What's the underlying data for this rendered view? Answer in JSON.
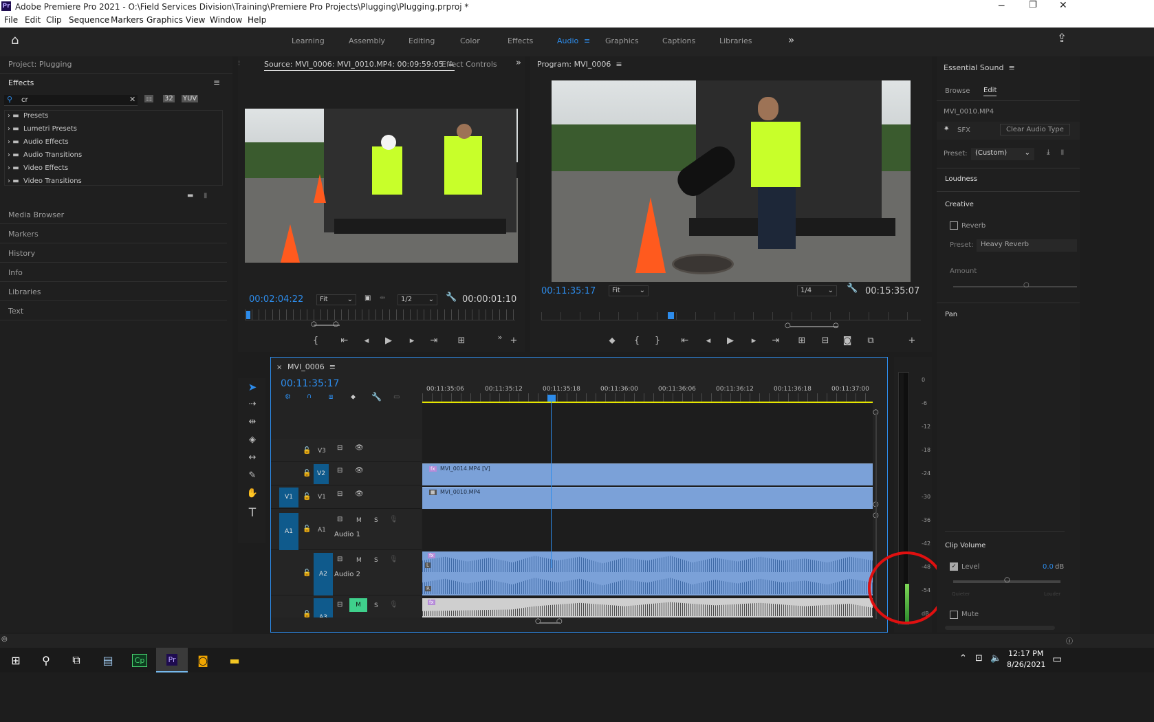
{
  "title_bar": {
    "app_icon": "Pr",
    "title": "Adobe Premiere Pro 2021 - O:\\Field Services Division\\Training\\Premiere Pro Projects\\Plugging\\Plugging.prproj *",
    "controls": [
      "minimize-icon",
      "restore-icon",
      "close-icon"
    ]
  },
  "menu": [
    "File",
    "Edit",
    "Clip",
    "Sequence",
    "Markers",
    "Graphics",
    "View",
    "Window",
    "Help"
  ],
  "workspaces": {
    "tabs": [
      "Learning",
      "Assembly",
      "Editing",
      "Color",
      "Effects",
      "Audio",
      "Graphics",
      "Captions",
      "Libraries"
    ],
    "active": "Audio",
    "more": "»"
  },
  "project_panel": {
    "title": "Project: Plugging",
    "effects_title": "Effects",
    "search_value": "cr",
    "folders": [
      "Presets",
      "Lumetri Presets",
      "Audio Effects",
      "Audio Transitions",
      "Video Effects",
      "Video Transitions"
    ],
    "collapsed_panels": [
      "Media Browser",
      "Markers",
      "History",
      "Info",
      "Libraries",
      "Text"
    ]
  },
  "source_monitor": {
    "tab_source": "Source: MVI_0006: MVI_0010.MP4: 00:09:59:05",
    "tab_effect_controls": "Effect Controls",
    "timecode": "00:02:04:22",
    "fit": "Fit",
    "resolution": "1/2",
    "duration": "00:00:01:10"
  },
  "program_monitor": {
    "title": "Program: MVI_0006",
    "timecode": "00:11:35:17",
    "fit": "Fit",
    "resolution": "1/4",
    "duration": "00:15:35:07"
  },
  "timeline": {
    "sequence_name": "MVI_0006",
    "timecode": "00:11:35:17",
    "ruler_labels": [
      "00:11:35:06",
      "00:11:35:12",
      "00:11:35:18",
      "00:11:36:00",
      "00:11:36:06",
      "00:11:36:12",
      "00:11:36:18",
      "00:11:37:00"
    ],
    "video_tracks": [
      {
        "name": "V3",
        "target": ""
      },
      {
        "name": "V2",
        "target": "V2"
      },
      {
        "name": "V1",
        "target": "V1"
      }
    ],
    "audio_tracks": [
      {
        "name": "A1",
        "label": "Audio 1",
        "target": "A1"
      },
      {
        "name": "A2",
        "label": "Audio 2",
        "target": "A2"
      },
      {
        "name": "A3",
        "label": "",
        "target": "A3"
      }
    ],
    "clips": {
      "v2": "MVI_0014.MP4 [V]",
      "v1": "MVI_0010.MP4"
    },
    "mute_label": "M",
    "solo_label": "S",
    "fx_label": "fx",
    "channel_l": "L",
    "channel_r": "R"
  },
  "audio_meter": {
    "scale": [
      "0",
      "-6",
      "-12",
      "-18",
      "-24",
      "-30",
      "-36",
      "-42",
      "-48",
      "-54",
      "dB"
    ]
  },
  "essential_sound": {
    "title": "Essential Sound",
    "tabs": [
      "Browse",
      "Edit"
    ],
    "active_tab": "Edit",
    "clip_name": "MVI_0010.MP4",
    "type": "SFX",
    "clear_button": "Clear Audio Type",
    "preset_label": "Preset:",
    "preset_value": "(Custom)",
    "sections": [
      "Loudness",
      "Creative",
      "Pan",
      "Clip Volume"
    ],
    "reverb_label": "Reverb",
    "reverb_preset_label": "Preset:",
    "reverb_preset_value": "Heavy Reverb",
    "amount_label": "Amount",
    "level_label": "Level",
    "level_value": "0.0",
    "level_unit": "dB",
    "quieter": "Quieter",
    "louder": "Louder",
    "mute_label": "Mute"
  },
  "taskbar": {
    "time": "12:17 PM",
    "date": "8/26/2021"
  },
  "colors": {
    "accent_blue": "#2d8ceb",
    "clip_blue": "#7ba1d8",
    "annotation_red": "#e01010",
    "mute_green": "#3fd08c"
  }
}
